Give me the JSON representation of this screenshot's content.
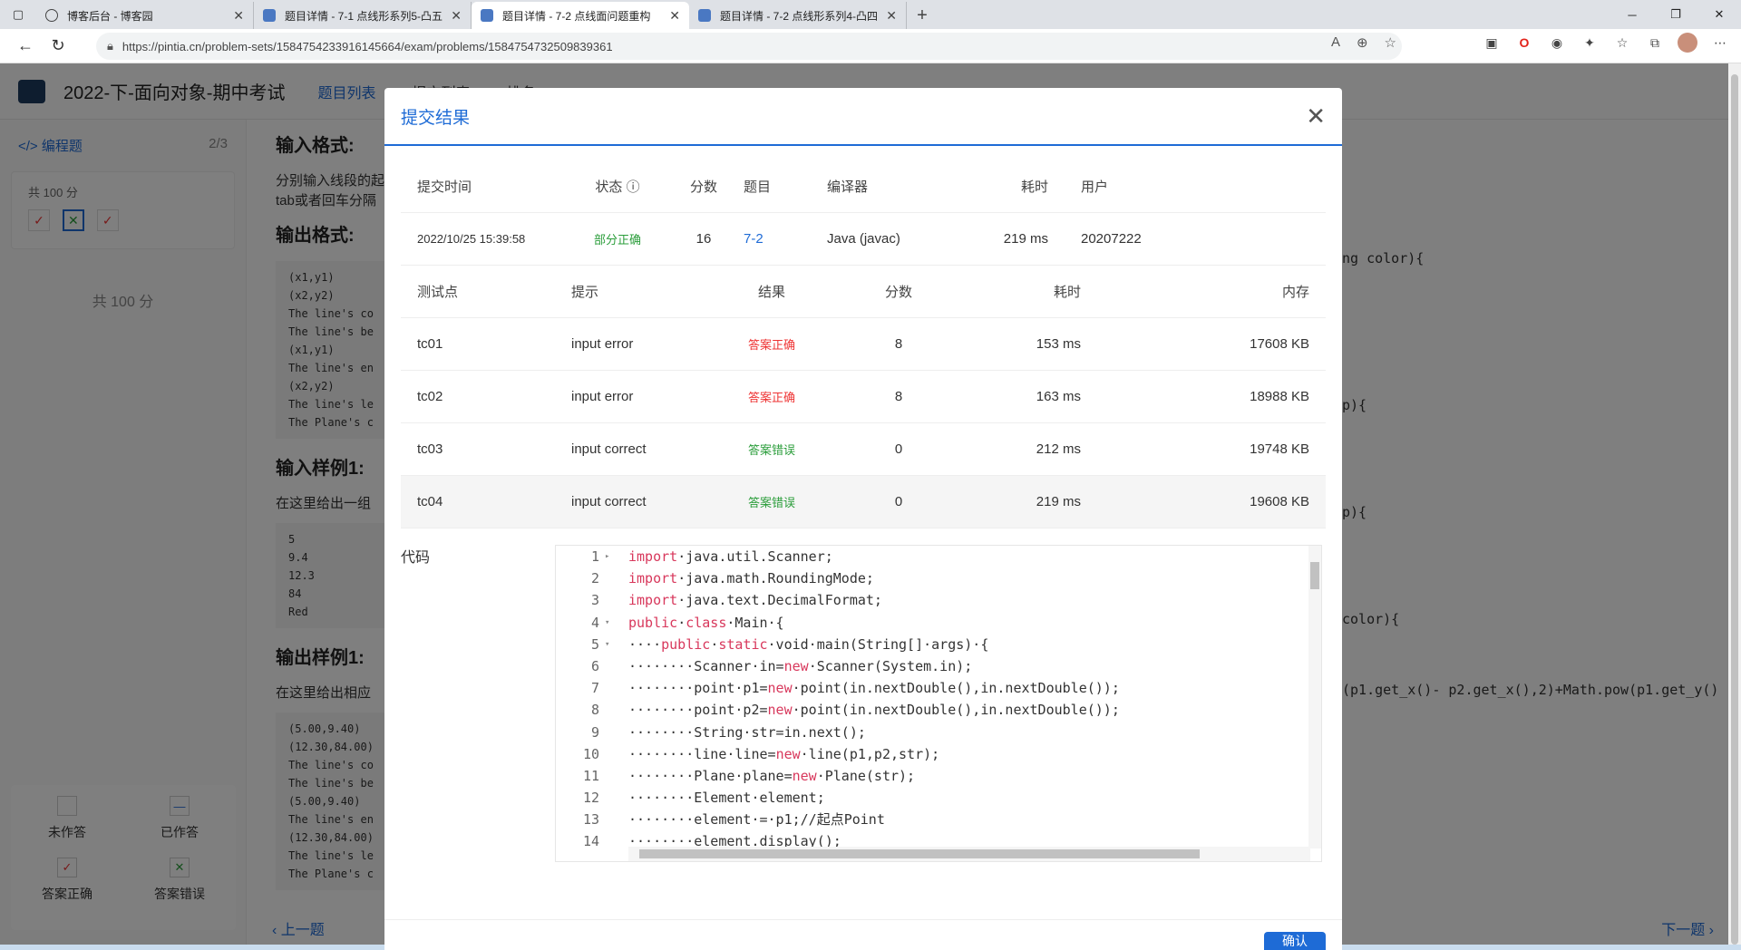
{
  "browser": {
    "tabs": [
      {
        "title": "博客后台 - 博客园",
        "icon": "blog-icon"
      },
      {
        "title": "题目详情 - 7-1 点线形系列5-凸五",
        "icon": "pintia-icon"
      },
      {
        "title": "题目详情 - 7-2 点线面问题重构",
        "icon": "pintia-icon"
      },
      {
        "title": "题目详情 - 7-2 点线形系列4-凸四",
        "icon": "pintia-icon"
      }
    ],
    "url": "https://pintia.cn/problem-sets/1584754233916145664/exam/problems/1584754732509839361"
  },
  "header": {
    "exam_title": "2022-下-面向对象-期中考试",
    "tabs": [
      "题目列表",
      "提交列表",
      "排名"
    ]
  },
  "sidebar": {
    "section": "编程题",
    "progress": "2/3",
    "score_label": "共 100 分",
    "total": "共 100 分",
    "legend": [
      {
        "label": "未作答"
      },
      {
        "label": "已作答"
      },
      {
        "label": "答案正确"
      },
      {
        "label": "答案错误"
      }
    ]
  },
  "content": {
    "input_format_title": "输入格式:",
    "input_format_text": "分别输入线段的起",
    "input_format_text2": "tab或者回车分隔",
    "output_format_title": "输出格式:",
    "output_format_pre": "(x1,y1)\n(x2,y2)\nThe line's co\nThe line's be\n(x1,y1)\nThe line's en\n(x2,y2)\nThe line's le\nThe Plane's c",
    "sample_in_title": "输入样例1:",
    "sample_in_text": "在这里给出一组",
    "sample_in_pre": "5\n9.4\n12.3\n84\nRed",
    "sample_out_title": "输出样例1:",
    "sample_out_text": "在这里给出相应",
    "sample_out_pre": "(5.00,9.40)\n(12.30,84.00)\nThe line's co\nThe line's be\n(5.00,9.40)\nThe line's en\n(12.30,84.00)\nThe line's le\nThe Plane's c",
    "prev": "上一题",
    "next": "下一题"
  },
  "right_code": [
    "ng color){",
    "p){",
    "p){",
    "color){",
    "(p1.get_x()- p2.get_x(),2)+Math.pow(p1.get_y()"
  ],
  "modal": {
    "title": "提交结果",
    "submission_headers": [
      "提交时间",
      "状态",
      "分数",
      "题目",
      "编译器",
      "耗时",
      "用户"
    ],
    "submission": {
      "time": "2022/10/25 15:39:58",
      "status": "部分正确",
      "score": "16",
      "problem": "7-2",
      "compiler": "Java (javac)",
      "elapsed": "219 ms",
      "user": "20207222"
    },
    "testcase_headers": [
      "测试点",
      "提示",
      "结果",
      "分数",
      "耗时",
      "内存"
    ],
    "testcases": [
      {
        "id": "tc01",
        "hint": "input error",
        "result": "答案正确",
        "score": "8",
        "time": "153 ms",
        "memory": "17608 KB"
      },
      {
        "id": "tc02",
        "hint": "input error",
        "result": "答案正确",
        "score": "8",
        "time": "163 ms",
        "memory": "18988 KB"
      },
      {
        "id": "tc03",
        "hint": "input correct",
        "result": "答案错误",
        "score": "0",
        "time": "212 ms",
        "memory": "19748 KB"
      },
      {
        "id": "tc04",
        "hint": "input correct",
        "result": "答案错误",
        "score": "0",
        "time": "219 ms",
        "memory": "19608 KB"
      }
    ],
    "code_label": "代码",
    "code_lines": [
      "import·java.util.Scanner;",
      "import·java.math.RoundingMode;",
      "import·java.text.DecimalFormat;",
      "public·class·Main·{",
      "····public·static·void·main(String[]·args)·{",
      "········Scanner·in=new·Scanner(System.in);",
      "········point·p1=new·point(in.nextDouble(),in.nextDouble());",
      "········point·p2=new·point(in.nextDouble(),in.nextDouble());",
      "········String·str=in.next();",
      "········line·line=new·line(p1,p2,str);",
      "········Plane·plane=new·Plane(str);",
      "········Element·element;",
      "········element·=·p1;//起点Point",
      "········element.display();"
    ],
    "confirm": "确认"
  },
  "colors": {
    "accent": "#1e6bd6",
    "correct": "#e33333",
    "wrong": "#2a9d3a"
  }
}
